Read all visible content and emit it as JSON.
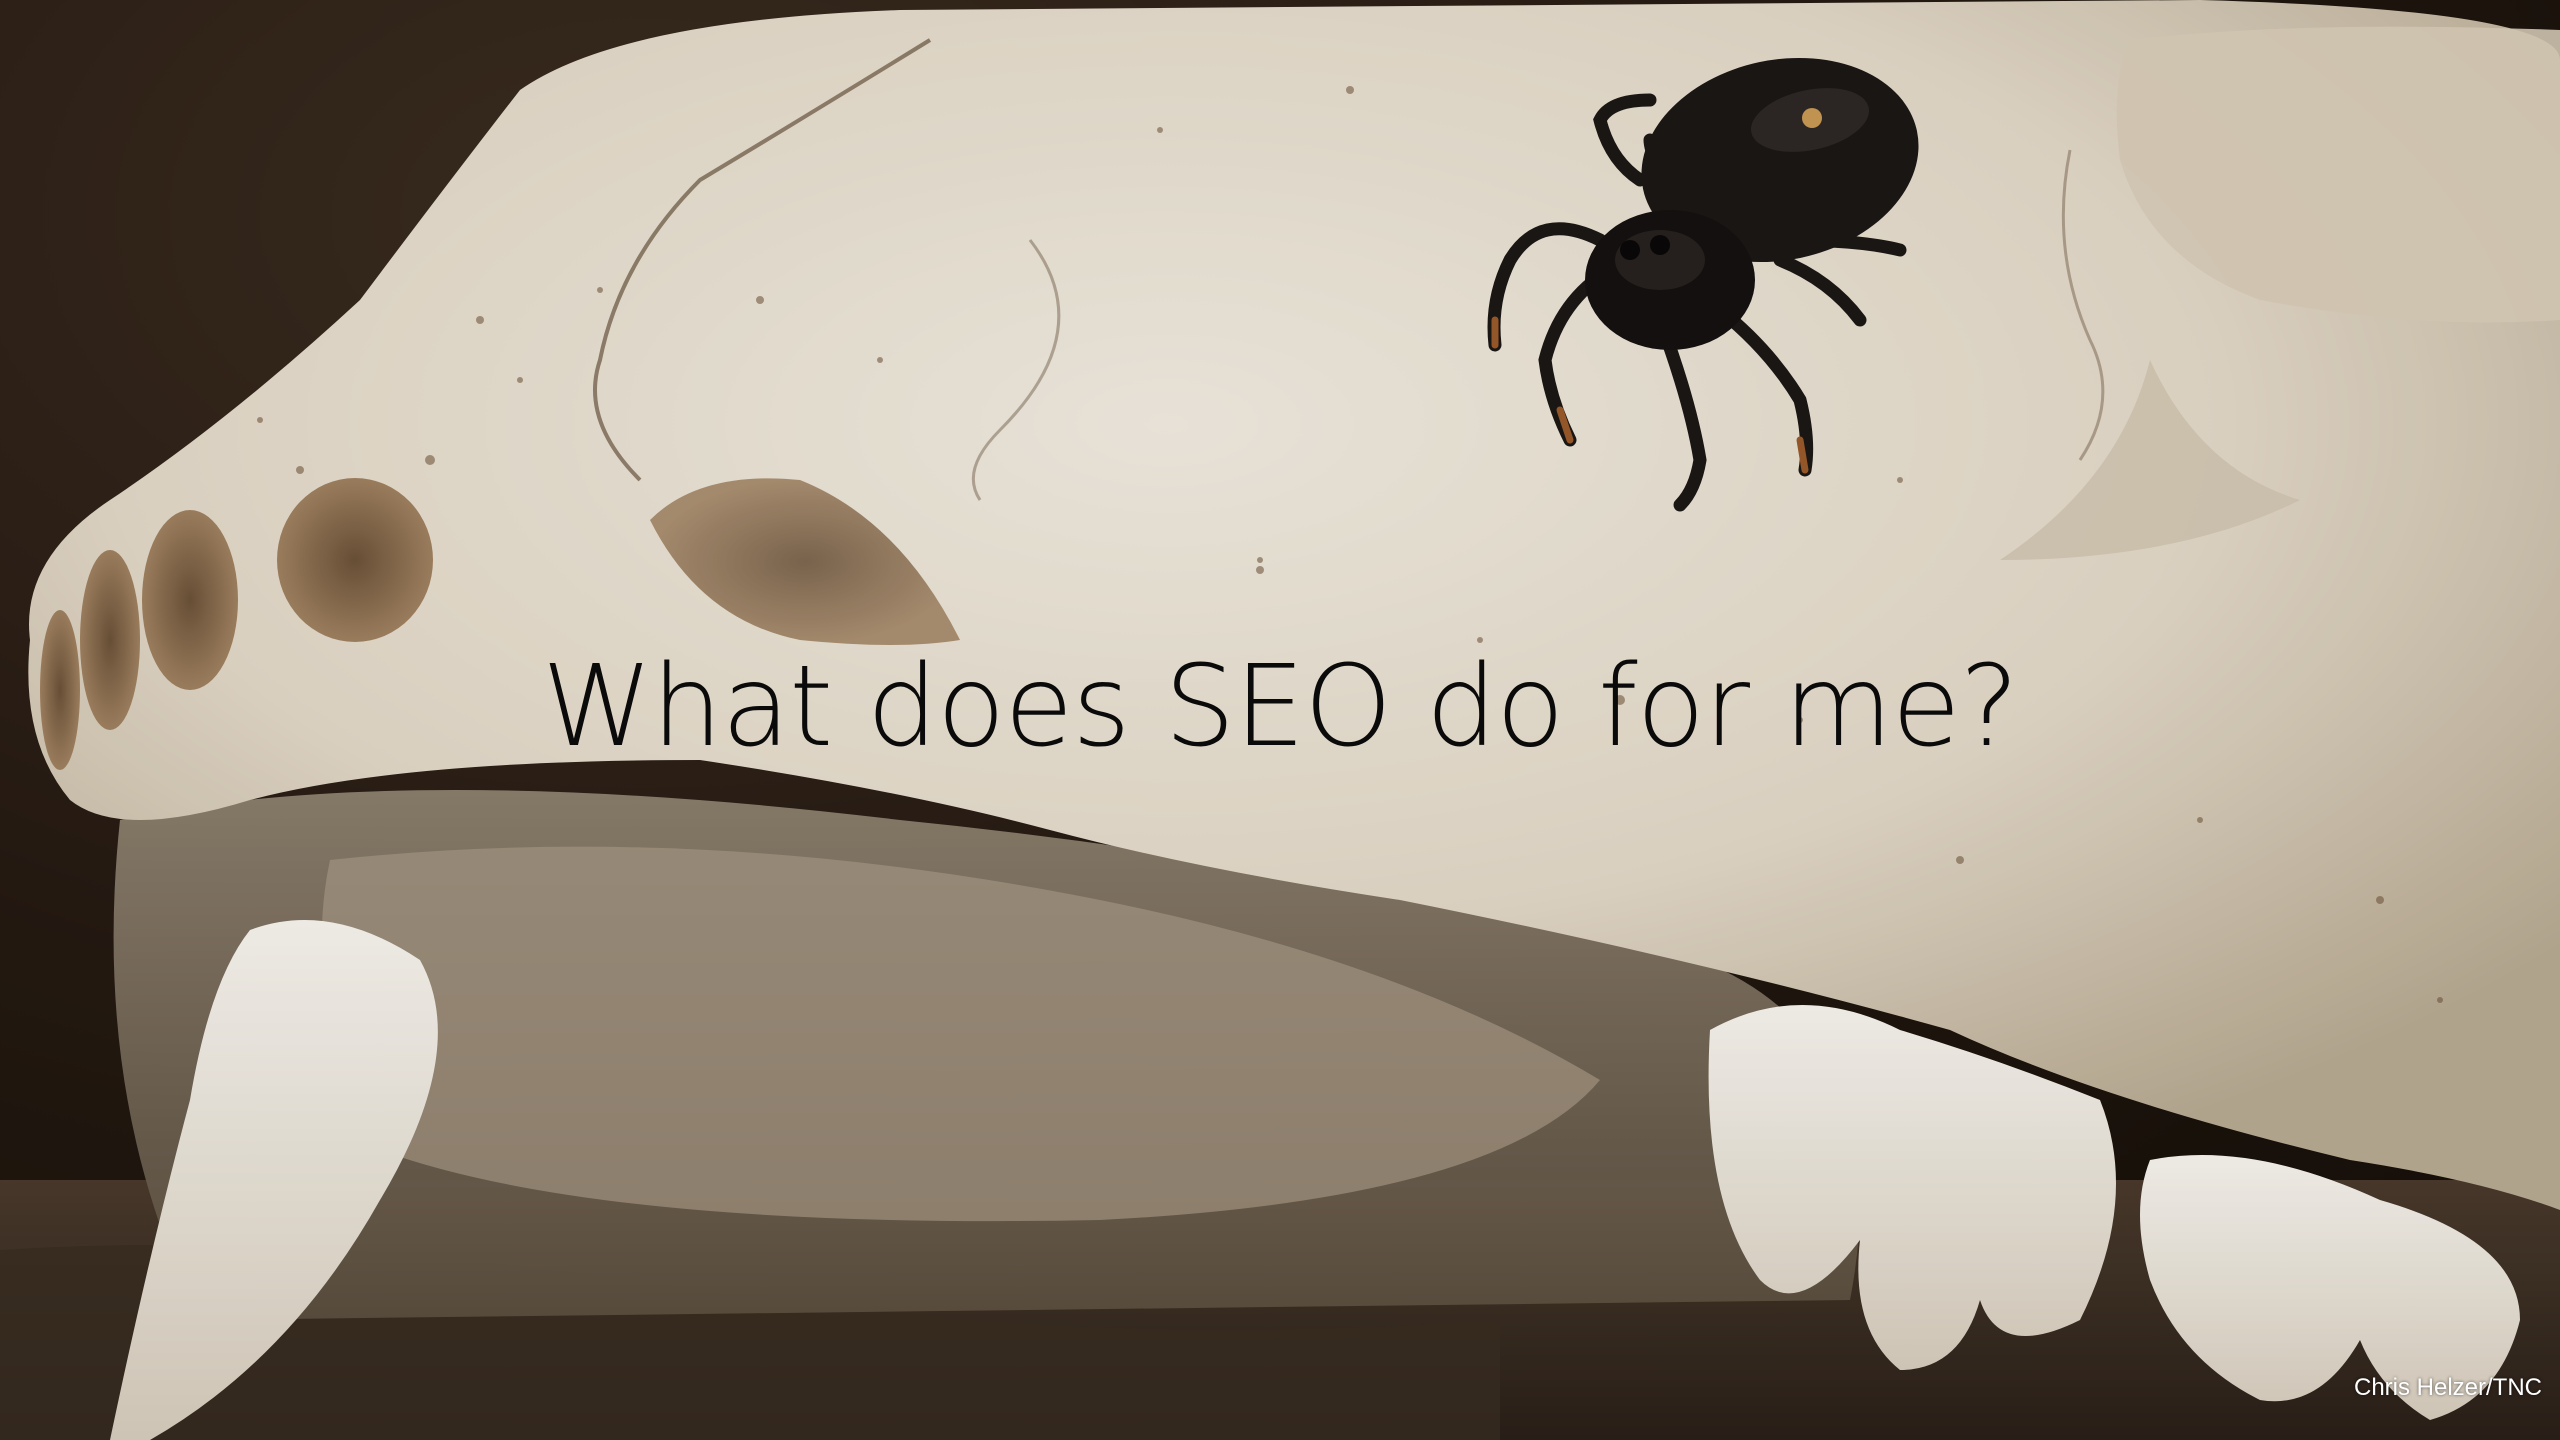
{
  "slide": {
    "title": "What does SEO do for me?",
    "photo_credit": "Chris Helzer/TNC"
  },
  "photo": {
    "subject": "jumping-spider-on-animal-skull",
    "colors": {
      "bone": "#e8e0d2",
      "bone_shadow": "#b9ad98",
      "background_dark": "#21170f",
      "spider": "#1b1715"
    }
  }
}
